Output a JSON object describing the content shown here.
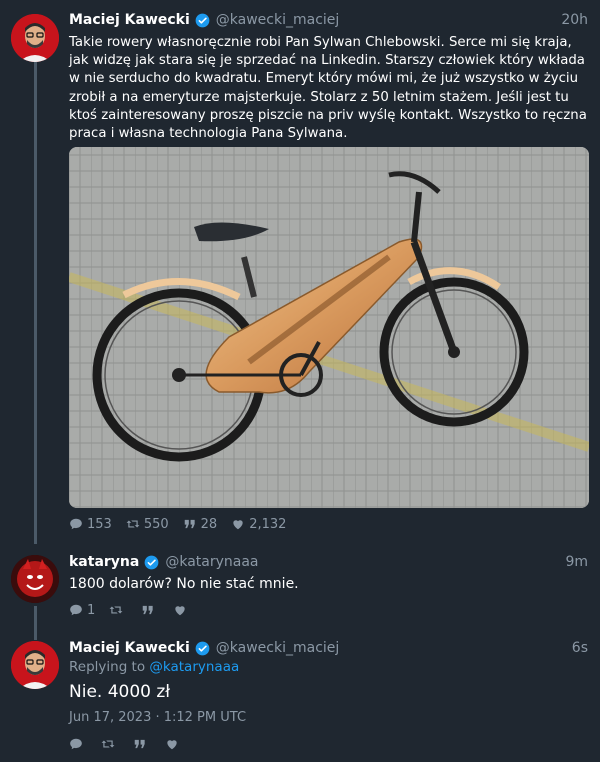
{
  "tweets": [
    {
      "name": "Maciej Kawecki",
      "handle": "@kawecki_maciej",
      "time": "20h",
      "text": "Takie rowery własnoręcznie robi Pan Sylwan Chlebowski. Serce mi się kraja, jak widzę jak stara się je sprzedać na Linkedin. Starszy człowiek który wkłada w nie serducho do kwadratu. Emeryt który mówi mi, że już wszystko w życiu zrobił a na emeryturze majsterkuje. Stolarz z 50 letnim stażem. Jeśli jest tu ktoś zainteresowany proszę piszcie na priv wyślę kontakt. Wszystko to ręczna praca i własna technologia Pana Sylwana.",
      "stats": {
        "replies": "153",
        "retweets": "550",
        "quotes": "28",
        "likes": "2,132"
      }
    },
    {
      "name": "kataryna",
      "handle": "@katarynaaa",
      "time": "9m",
      "text": "1800 dolarów? No nie stać mnie.",
      "stats": {
        "replies": "1",
        "retweets": "",
        "quotes": "",
        "likes": ""
      }
    },
    {
      "name": "Maciej Kawecki",
      "handle": "@kawecki_maciej",
      "time": "6s",
      "replying_prefix": "Replying to",
      "replying_to": "@katarynaaa",
      "text": "Nie. 4000 zł",
      "date": "Jun 17, 2023 · 1:12 PM UTC",
      "stats": {
        "replies": "",
        "retweets": "",
        "quotes": "",
        "likes": ""
      }
    }
  ],
  "colors": {
    "background": "#1f2730",
    "secondary_text": "#8b98a5",
    "accent": "#1d9bf0",
    "thread_line": "#4b5a68"
  },
  "icons": [
    "verified-badge-icon",
    "reply-icon",
    "retweet-icon",
    "quote-icon",
    "like-icon"
  ]
}
